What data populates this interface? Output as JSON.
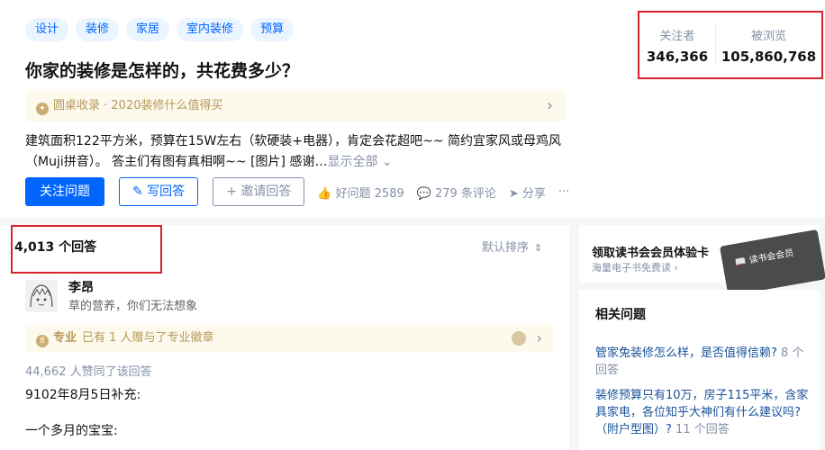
{
  "topics": [
    "设计",
    "装修",
    "家居",
    "室内装修",
    "预算"
  ],
  "question": {
    "title": "你家的装修是怎样的，共花费多少？",
    "banner": "圆桌收录 · 2020装修什么值得买",
    "detail": "建筑面积122平方米，预算在15W左右（软硬装+电器），肯定会花超吧~~ 简约宜家风或母鸡风（Muji拼音）。 答主们有图有真相啊~~ [图片] 感谢…",
    "show_all": "显示全部"
  },
  "actions": {
    "follow": "关注问题",
    "write": "写回答",
    "invite": "邀请回答",
    "good": "好问题 2589",
    "comments": "279 条评论",
    "share": "分享",
    "more": "···"
  },
  "stats": {
    "followers_label": "关注者",
    "followers_value": "346,366",
    "views_label": "被浏览",
    "views_value": "105,860,768"
  },
  "answers": {
    "count": "4,013 个回答",
    "sort": "默认排序",
    "author": "李昂",
    "bio": "草的营养，你们无法想象",
    "badge_title": "专业",
    "badge_text": "已有 1 人赠与了专业徽章",
    "upvotes": "44,662 人赞同了该回答",
    "line1": "9102年8月5日补充:",
    "line2": "一个多月的宝宝:"
  },
  "sidebar": {
    "card_title": "领取读书会会员体验卡",
    "card_sub": "海量电子书免费读",
    "book_label": "读书会会员",
    "related_title": "相关问题",
    "related": [
      {
        "q": "管家兔装修怎么样，是否值得信赖?",
        "count": "8 个回答"
      },
      {
        "q": "装修预算只有10万，房子115平米，含家具家电，各位知乎大神们有什么建议吗?（附户型图）?",
        "count": "11 个回答"
      }
    ]
  }
}
